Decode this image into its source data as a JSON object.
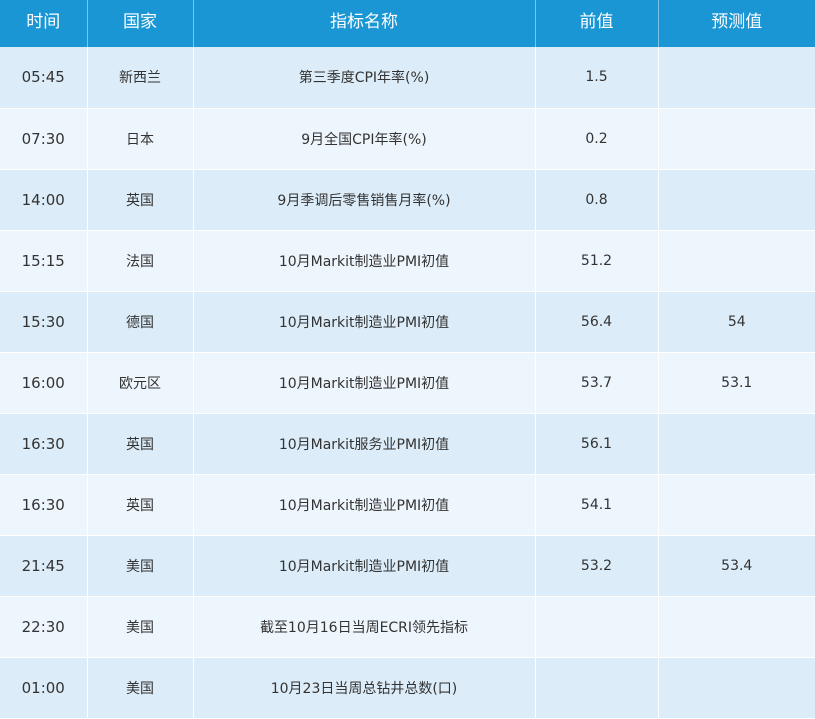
{
  "table": {
    "headers": [
      "时间",
      "国家",
      "指标名称",
      "前值",
      "预测值"
    ],
    "rows": [
      {
        "time": "05:45",
        "country": "新西兰",
        "indicator": "第三季度CPI年率(%)",
        "previous": "1.5",
        "forecast": ""
      },
      {
        "time": "07:30",
        "country": "日本",
        "indicator": "9月全国CPI年率(%)",
        "previous": "0.2",
        "forecast": ""
      },
      {
        "time": "14:00",
        "country": "英国",
        "indicator": "9月季调后零售销售月率(%)",
        "previous": "0.8",
        "forecast": ""
      },
      {
        "time": "15:15",
        "country": "法国",
        "indicator": "10月Markit制造业PMI初值",
        "previous": "51.2",
        "forecast": ""
      },
      {
        "time": "15:30",
        "country": "德国",
        "indicator": "10月Markit制造业PMI初值",
        "previous": "56.4",
        "forecast": "54"
      },
      {
        "time": "16:00",
        "country": "欧元区",
        "indicator": "10月Markit制造业PMI初值",
        "previous": "53.7",
        "forecast": "53.1"
      },
      {
        "time": "16:30",
        "country": "英国",
        "indicator": "10月Markit服务业PMI初值",
        "previous": "56.1",
        "forecast": ""
      },
      {
        "time": "16:30",
        "country": "英国",
        "indicator": "10月Markit制造业PMI初值",
        "previous": "54.1",
        "forecast": ""
      },
      {
        "time": "21:45",
        "country": "美国",
        "indicator": "10月Markit制造业PMI初值",
        "previous": "53.2",
        "forecast": "53.4"
      },
      {
        "time": "22:30",
        "country": "美国",
        "indicator": "截至10月16日当周ECRI领先指标",
        "previous": "",
        "forecast": ""
      },
      {
        "time": "01:00",
        "country": "美国",
        "indicator": "10月23日当周总钻井总数(口)",
        "previous": "",
        "forecast": ""
      }
    ]
  },
  "colors": {
    "header_bg": "#1a96d4",
    "row_odd": "#dcedf9",
    "row_even": "#eef6fd",
    "text": "#333333"
  }
}
